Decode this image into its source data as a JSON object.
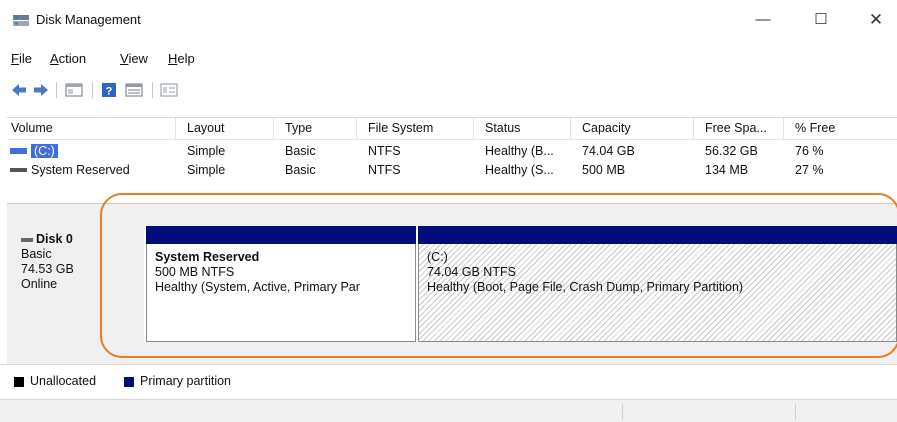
{
  "window": {
    "title": "Disk Management",
    "controls": {
      "minimize": "—",
      "maximize": "☐",
      "close": "✕"
    }
  },
  "menu": {
    "file": {
      "mnemonic": "F",
      "rest": "ile"
    },
    "action": {
      "mnemonic": "A",
      "rest": "ction"
    },
    "view": {
      "mnemonic": "V",
      "rest": "iew"
    },
    "help": {
      "mnemonic": "H",
      "rest": "elp"
    }
  },
  "toolbar": {
    "icons": [
      "back-arrow-icon",
      "forward-arrow-icon",
      "console-tree-icon",
      "help-icon",
      "disk-list-icon",
      "properties-icon"
    ]
  },
  "volume_list": {
    "columns": [
      "Volume",
      "Layout",
      "Type",
      "File System",
      "Status",
      "Capacity",
      "Free Spa...",
      "% Free"
    ],
    "rows": [
      {
        "volume": "(C:)",
        "layout": "Simple",
        "type": "Basic",
        "fs": "NTFS",
        "status": "Healthy (B...",
        "capacity": "74.04 GB",
        "free": "56.32 GB",
        "pct": "76 %",
        "selected": true
      },
      {
        "volume": "System Reserved",
        "layout": "Simple",
        "type": "Basic",
        "fs": "NTFS",
        "status": "Healthy (S...",
        "capacity": "500 MB",
        "free": "134 MB",
        "pct": "27 %",
        "selected": false
      }
    ]
  },
  "disk": {
    "name": "Disk 0",
    "kind": "Basic",
    "size": "74.53 GB",
    "state": "Online",
    "partitions": [
      {
        "name": "System Reserved",
        "size_fs": "500 MB NTFS",
        "status": "Healthy (System, Active, Primary Par"
      },
      {
        "name": "(C:)",
        "size_fs": "74.04 GB NTFS",
        "status": "Healthy (Boot, Page File, Crash Dump, Primary Partition)"
      }
    ]
  },
  "legend": {
    "unallocated": "Unallocated",
    "primary": "Primary partition"
  },
  "colors": {
    "primary_partition": "#000e7a",
    "unallocated": "#000000",
    "selection": "#3f6fd6",
    "highlight": "#e57e26"
  }
}
